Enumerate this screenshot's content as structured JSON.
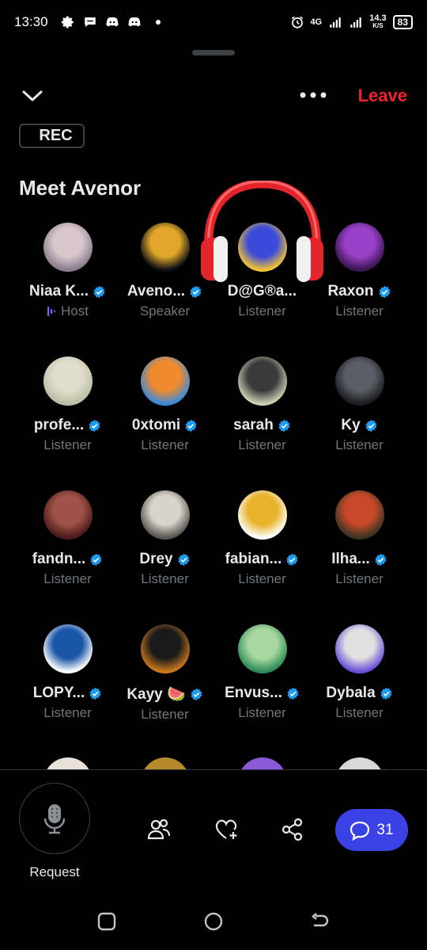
{
  "status_bar": {
    "time": "13:30",
    "network": "4G",
    "speed": "14.3",
    "speed_unit": "K/S",
    "battery": "83"
  },
  "header": {
    "leave_label": "Leave",
    "rec_label": "REC",
    "title": "Meet Avenor"
  },
  "participants": [
    {
      "name": "Niaa K...",
      "role": "Host",
      "verified": true,
      "colors": [
        "#8b7d8f",
        "#d8c6cc"
      ]
    },
    {
      "name": "Aveno...",
      "role": "Speaker",
      "verified": true,
      "colors": [
        "#0d0f14",
        "#e2a72a"
      ]
    },
    {
      "name": "D@G®a...",
      "role": "Listener",
      "verified": false,
      "colors": [
        "#f1c232",
        "#3b4bd9"
      ]
    },
    {
      "name": "Raxon",
      "role": "Listener",
      "verified": true,
      "colors": [
        "#3a1550",
        "#9a40c8"
      ]
    },
    {
      "name": "profe...",
      "role": "Listener",
      "verified": true,
      "colors": [
        "#b9bfa5",
        "#e2dccb"
      ]
    },
    {
      "name": "0xtomi",
      "role": "Listener",
      "verified": true,
      "colors": [
        "#3b8ad9",
        "#f08a2c"
      ]
    },
    {
      "name": "sarah",
      "role": "Listener",
      "verified": true,
      "colors": [
        "#c9d0b4",
        "#3a3a3a"
      ]
    },
    {
      "name": "Ky",
      "role": "Listener",
      "verified": true,
      "colors": [
        "#1c1c20",
        "#5a5d66"
      ]
    },
    {
      "name": "fandn...",
      "role": "Listener",
      "verified": true,
      "colors": [
        "#4a1b18",
        "#a0524a"
      ]
    },
    {
      "name": "Drey",
      "role": "Listener",
      "verified": true,
      "colors": [
        "#5a5550",
        "#d8d4cc"
      ]
    },
    {
      "name": "fabian...",
      "role": "Listener",
      "verified": true,
      "colors": [
        "#ffffff",
        "#e8b32a"
      ]
    },
    {
      "name": "Ilha...",
      "role": "Listener",
      "verified": true,
      "colors": [
        "#3a3322",
        "#c8492a"
      ]
    },
    {
      "name": "LOPY...",
      "role": "Listener",
      "verified": true,
      "colors": [
        "#ffffff",
        "#1a56a8"
      ]
    },
    {
      "name": "Kayy 🍉",
      "role": "Listener",
      "verified": true,
      "colors": [
        "#c9781d",
        "#1a1a1a"
      ]
    },
    {
      "name": "Envus...",
      "role": "Listener",
      "verified": true,
      "colors": [
        "#2e8b57",
        "#a8d8a0"
      ]
    },
    {
      "name": "Dybala",
      "role": "Listener",
      "verified": true,
      "colors": [
        "#6b4fd8",
        "#e0e0e0"
      ]
    }
  ],
  "partial_avatars": [
    {
      "color": "#e8e2da"
    },
    {
      "color": "#b58a2c"
    },
    {
      "color": "#8a5ad8"
    },
    {
      "color": "#d8d8d8"
    }
  ],
  "bottom": {
    "request_label": "Request",
    "chat_count": "31"
  },
  "colors": {
    "accent": "#1d9bf0",
    "leave": "#f4212e",
    "chat_button": "#3a42e6",
    "muted_text": "#71767b"
  },
  "icons": {
    "collapse": "chevron-down-icon",
    "more": "more-icon",
    "mic": "microphone-icon",
    "people": "people-icon",
    "heart": "heart-plus-icon",
    "share": "share-icon",
    "chat": "chat-bubble-icon"
  }
}
